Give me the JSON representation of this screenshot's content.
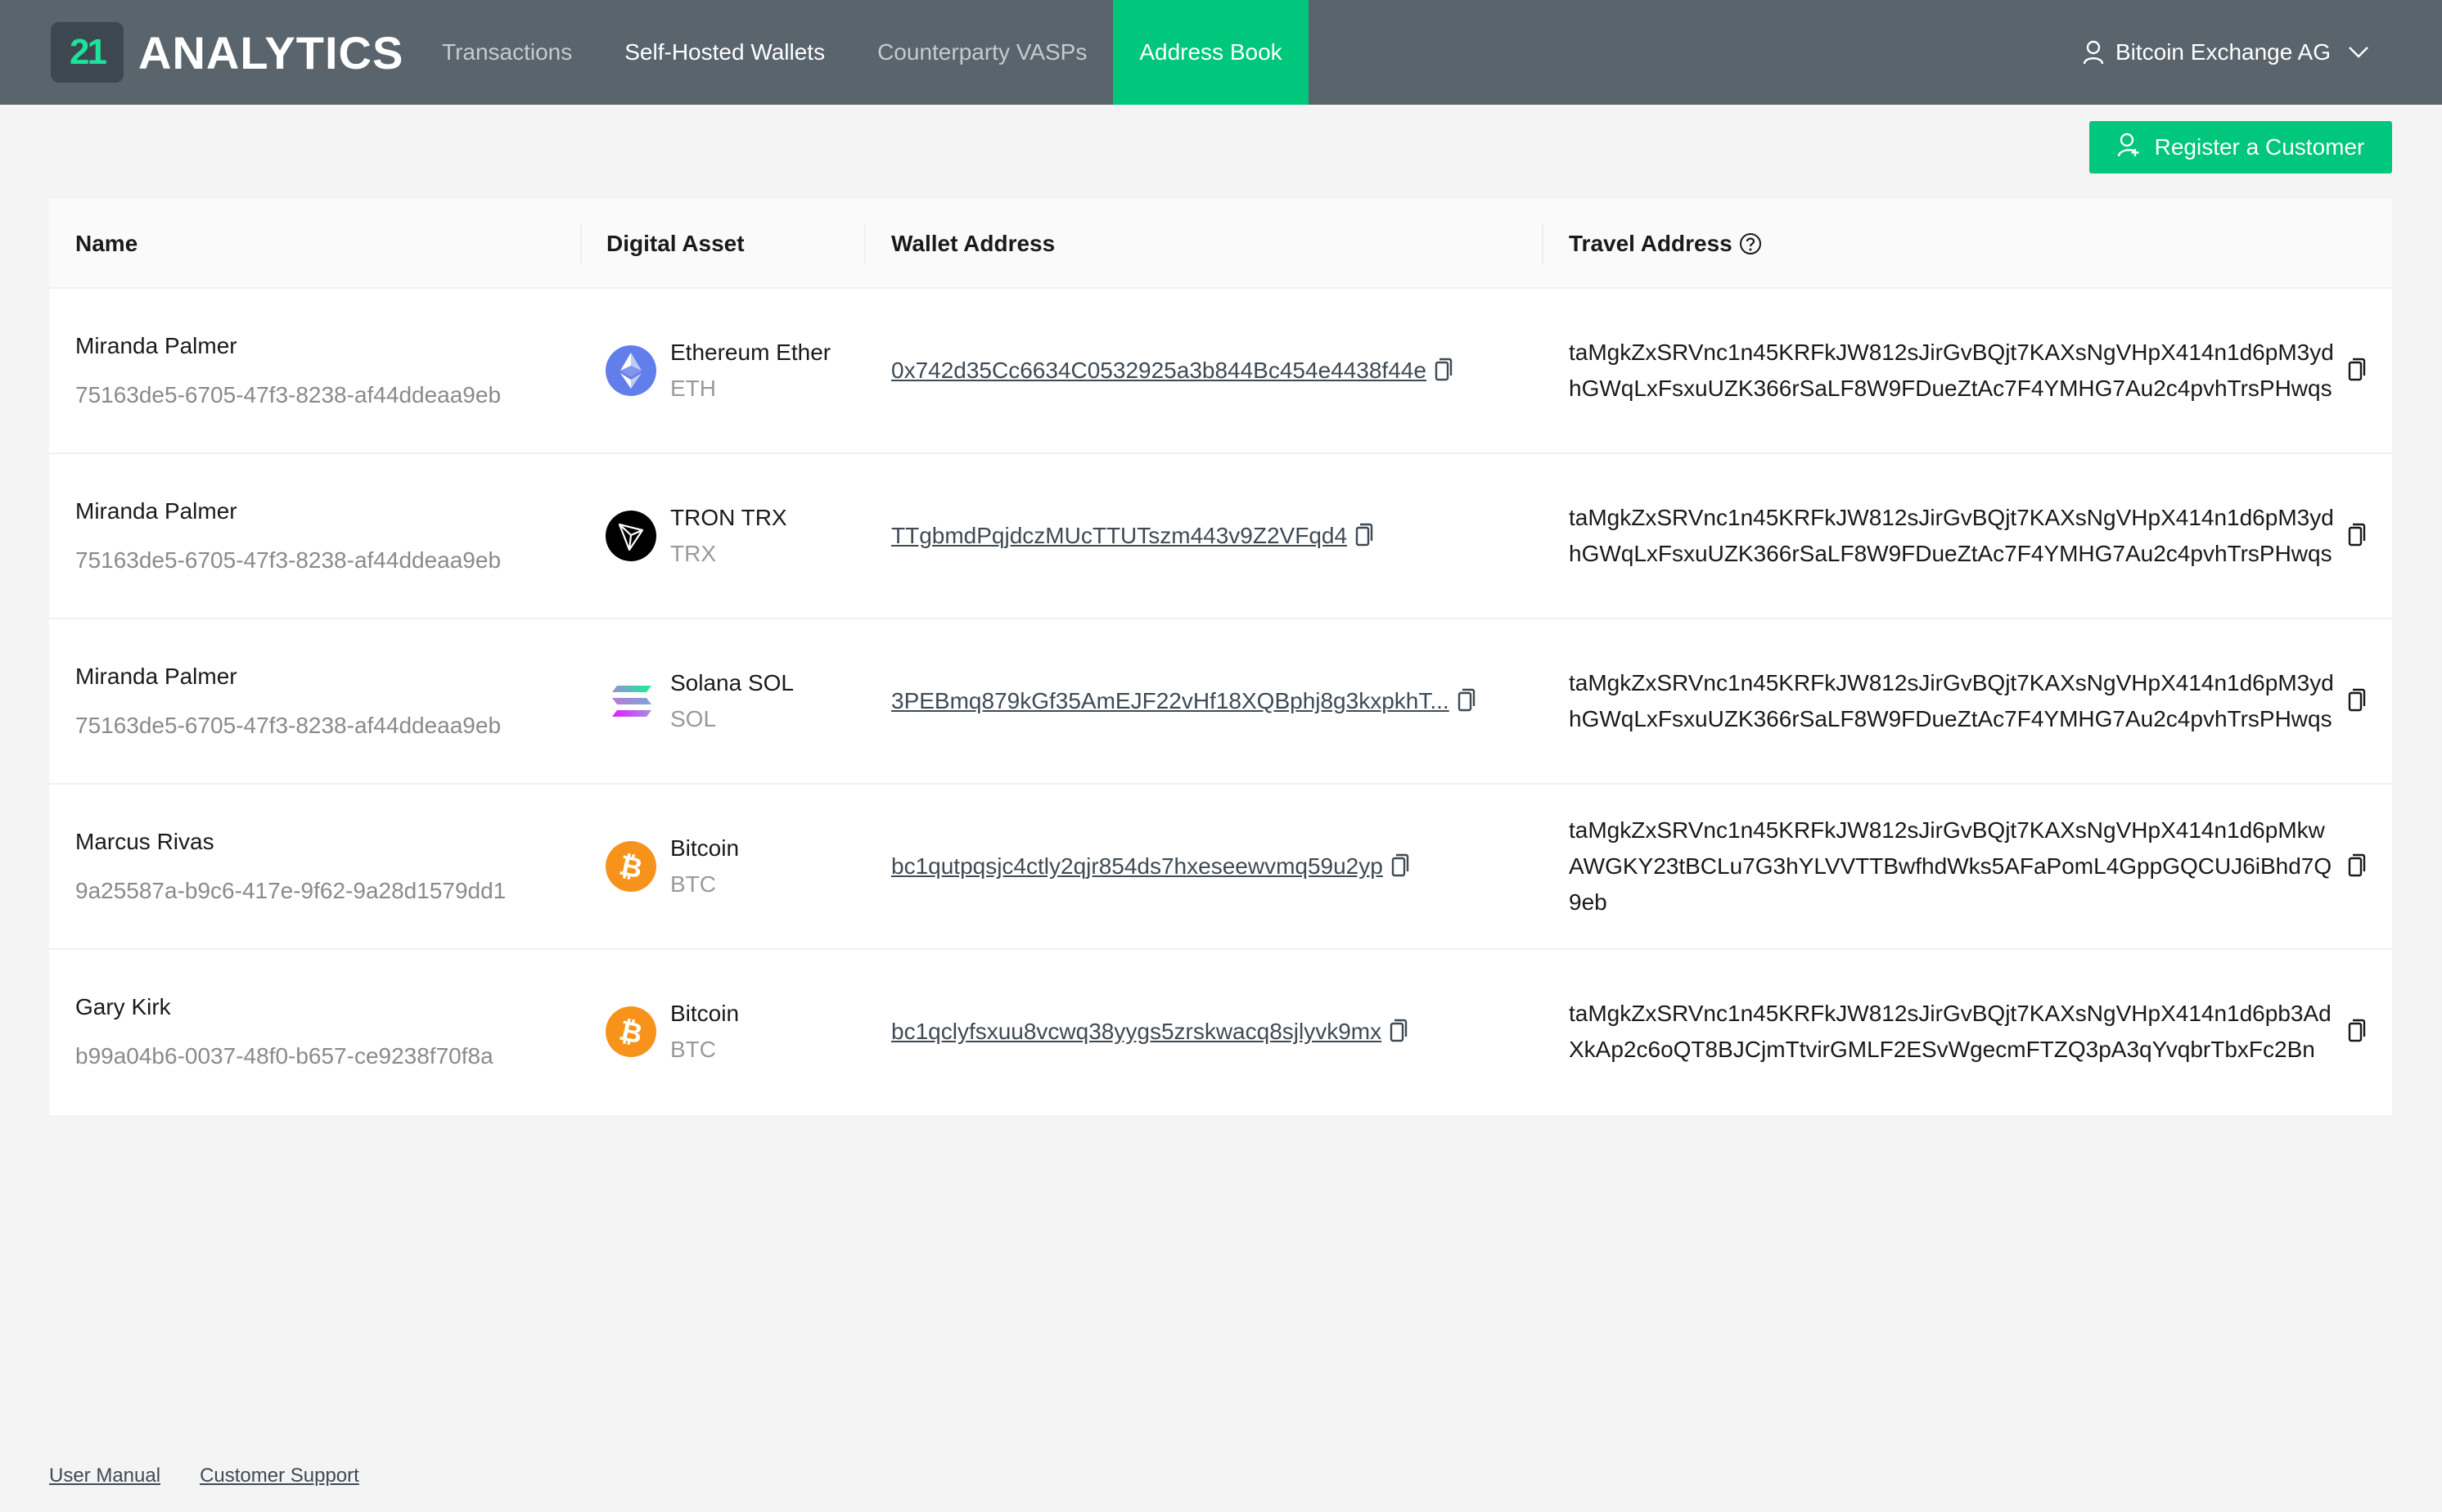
{
  "app": {
    "logo_mark": "21",
    "logo_text": "ANALYTICS",
    "brand_color": "#00c77b",
    "header_bg": "#59646d"
  },
  "nav": {
    "items": [
      {
        "label": "Transactions",
        "active": false
      },
      {
        "label": "Self-Hosted Wallets",
        "active": false
      },
      {
        "label": "Counterparty VASPs",
        "active": false
      },
      {
        "label": "Address Book",
        "active": true
      }
    ]
  },
  "user_menu": {
    "icon": "user-icon",
    "label": "Bitcoin Exchange AG",
    "dropdown_icon": "chevron-down-icon"
  },
  "actions": {
    "register_label": "Register a Customer",
    "register_icon": "user-plus-icon"
  },
  "table": {
    "columns": [
      "Name",
      "Digital Asset",
      "Wallet Address",
      "Travel Address"
    ],
    "travel_help_icon": "question-circle-icon",
    "rows": [
      {
        "name": "Miranda Palmer",
        "id": "75163de5-6705-47f3-8238-af44ddeaa9eb",
        "asset_name": "Ethereum Ether",
        "asset_symbol": "ETH",
        "asset_icon": "ethereum-icon",
        "wallet_address": "0x742d35Cc6634C0532925a3b844Bc454e4438f44e",
        "travel_address": "taMgkZxSRVnc1n45KRFkJW812sJirGvBQjt7KAXsNgVHpX414n1d6pM3ydhGWqLxFsxuUZK366rSaLF8W9FDueZtAc7F4YMHG7Au2c4pvhTrsPHwqs"
      },
      {
        "name": "Miranda Palmer",
        "id": "75163de5-6705-47f3-8238-af44ddeaa9eb",
        "asset_name": "TRON TRX",
        "asset_symbol": "TRX",
        "asset_icon": "tron-icon",
        "wallet_address": "TTgbmdPqjdczMUcTTUTszm443v9Z2VFqd4",
        "travel_address": "taMgkZxSRVnc1n45KRFkJW812sJirGvBQjt7KAXsNgVHpX414n1d6pM3ydhGWqLxFsxuUZK366rSaLF8W9FDueZtAc7F4YMHG7Au2c4pvhTrsPHwqs"
      },
      {
        "name": "Miranda Palmer",
        "id": "75163de5-6705-47f3-8238-af44ddeaa9eb",
        "asset_name": "Solana SOL",
        "asset_symbol": "SOL",
        "asset_icon": "solana-icon",
        "wallet_address": "3PEBmq879kGf35AmEJF22vHf18XQBphj8g3kxpkhT...",
        "travel_address": "taMgkZxSRVnc1n45KRFkJW812sJirGvBQjt7KAXsNgVHpX414n1d6pM3ydhGWqLxFsxuUZK366rSaLF8W9FDueZtAc7F4YMHG7Au2c4pvhTrsPHwqs"
      },
      {
        "name": "Marcus Rivas",
        "id": "9a25587a-b9c6-417e-9f62-9a28d1579dd1",
        "asset_name": "Bitcoin",
        "asset_symbol": "BTC",
        "asset_icon": "bitcoin-icon",
        "wallet_address": "bc1qutpqsjc4ctly2qjr854ds7hxeseewvmq59u2yp",
        "travel_address": "taMgkZxSRVnc1n45KRFkJW812sJirGvBQjt7KAXsNgVHpX414n1d6pMkwAWGKY23tBCLu7G3hYLVVTTBwfhdWks5AFaPomL4GppGQCUJ6iBhd7Q9eb"
      },
      {
        "name": "Gary Kirk",
        "id": "b99a04b6-0037-48f0-b657-ce9238f70f8a",
        "asset_name": "Bitcoin",
        "asset_symbol": "BTC",
        "asset_icon": "bitcoin-icon",
        "wallet_address": "bc1qclyfsxuu8vcwq38yygs5zrskwacq8sjlyvk9mx",
        "travel_address": "taMgkZxSRVnc1n45KRFkJW812sJirGvBQjt7KAXsNgVHpX414n1d6pb3AdXkAp2c6oQT8BJCjmTtvirGMLF2ESvWgecmFTZQ3pA3qYvqbrTbxFc2Bn"
      }
    ]
  },
  "footer": {
    "links": [
      "User Manual",
      "Customer Support"
    ]
  }
}
